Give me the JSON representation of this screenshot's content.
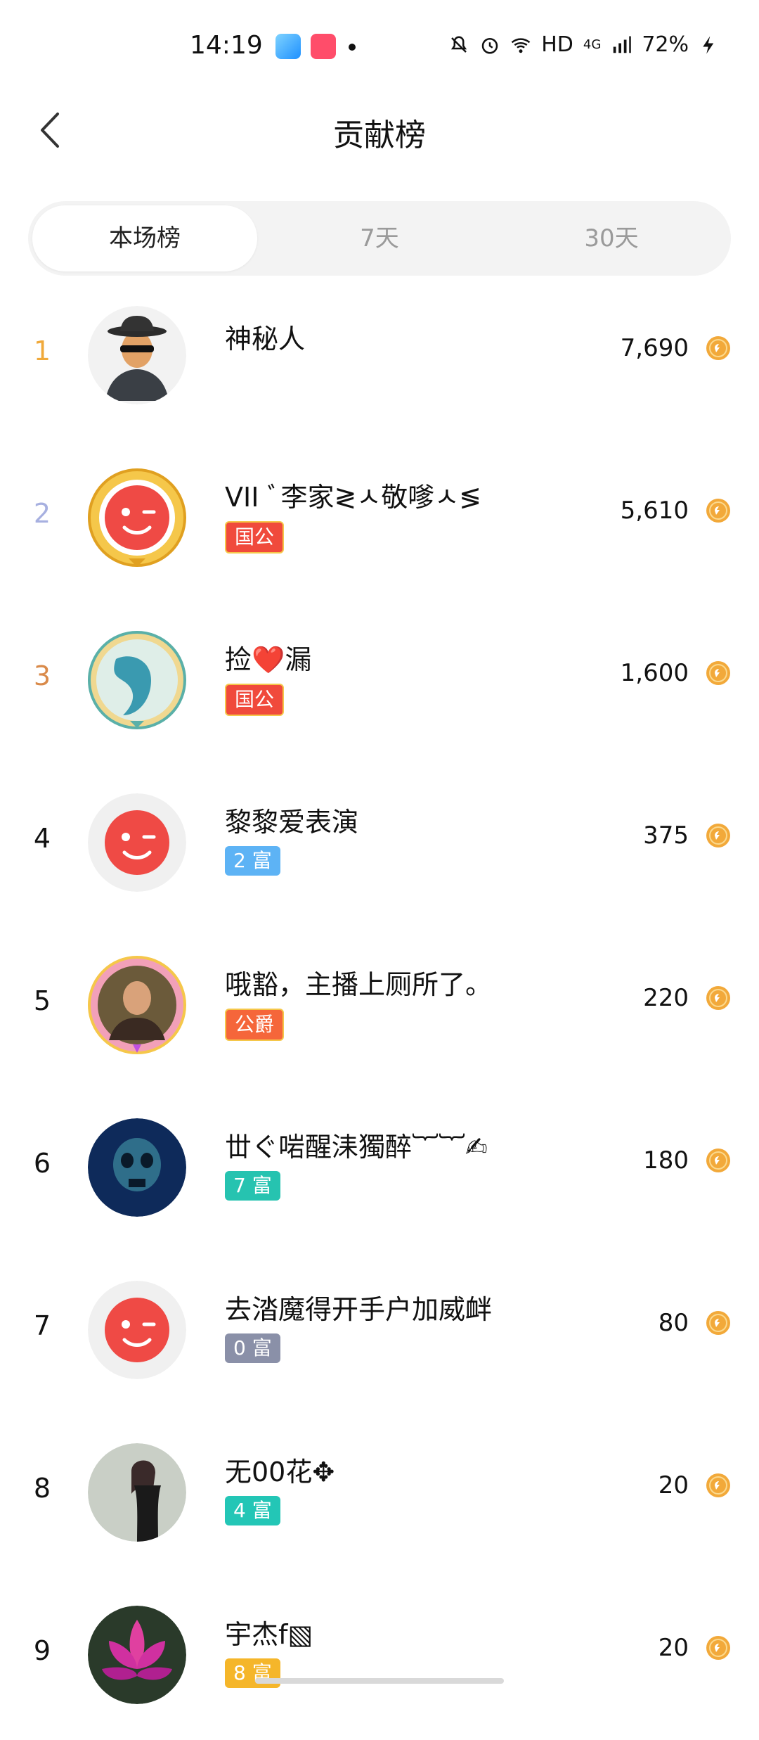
{
  "status_bar": {
    "time": "14:19",
    "network": "HD",
    "cellular": "4G",
    "battery": "72%",
    "icons": [
      "telegram-icon",
      "app-icon",
      "notification-dot",
      "mute-bell-icon",
      "alarm-icon",
      "wifi-icon",
      "signal-icon",
      "charging-icon"
    ]
  },
  "header": {
    "title": "贡献榜",
    "back_icon": "chevron-left-icon"
  },
  "tabs": [
    {
      "label": "本场榜",
      "active": true
    },
    {
      "label": "7天",
      "active": false
    },
    {
      "label": "30天",
      "active": false
    }
  ],
  "colors": {
    "rank1": "#f0a93a",
    "rank2": "#a7b0e0",
    "rank3": "#d98a4a",
    "coin": "#f2a93a",
    "badge_rich_2": "#5db3f5",
    "badge_rich_7": "#26c3b0",
    "badge_rich_0": "#8a90a8",
    "badge_rich_4": "#23c6b6",
    "badge_rich_8": "#f5b62a",
    "badge_noble": "#f04a3c"
  },
  "rows": [
    {
      "rank": "1",
      "name": "神秘人",
      "badge": "",
      "amount": "7,690",
      "avatar": "mystery-man-avatar"
    },
    {
      "rank": "2",
      "name": "VII ﾞ李家≷ㅅ敬嗲ㅅ≶",
      "badge": "国公",
      "amount": "5,610",
      "avatar": "default-avatar-gold-frame"
    },
    {
      "rank": "3",
      "name": "捡❤️漏",
      "badge": "国公",
      "amount": "1,600",
      "avatar": "dragon-avatar"
    },
    {
      "rank": "4",
      "name": "黎黎爱表演",
      "badge": "2 富",
      "amount": "375",
      "avatar": "default-avatar"
    },
    {
      "rank": "5",
      "name": "哦豁，主播上厕所了。",
      "badge": "公爵",
      "amount": "220",
      "avatar": "man-photo-avatar"
    },
    {
      "rank": "6",
      "name": "丗ぐ啱醒洡獨醉︸︸✍",
      "badge": "7 富",
      "amount": "180",
      "avatar": "skull-avatar"
    },
    {
      "rank": "7",
      "name": "去涾魔得开手户加威衅",
      "badge": "0 富",
      "amount": "80",
      "avatar": "default-avatar"
    },
    {
      "rank": "8",
      "name": "无00花✥",
      "badge": "4 富",
      "amount": "20",
      "avatar": "woman-photo-avatar"
    },
    {
      "rank": "9",
      "name": "宇杰f▧",
      "badge": "8 富",
      "amount": "20",
      "avatar": "lotus-avatar"
    }
  ]
}
